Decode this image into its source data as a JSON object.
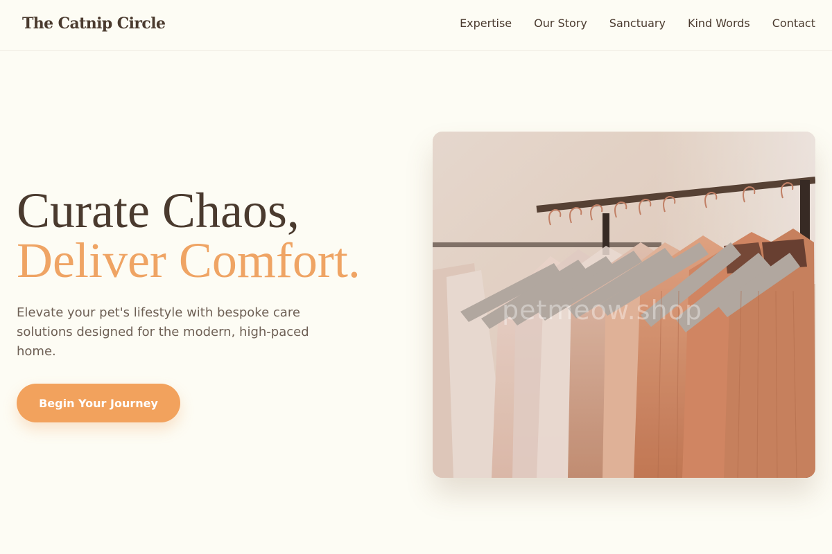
{
  "brand": {
    "name": "The Catnip Circle"
  },
  "nav": {
    "items": [
      {
        "label": "Expertise"
      },
      {
        "label": "Our Story"
      },
      {
        "label": "Sanctuary"
      },
      {
        "label": "Kind Words"
      },
      {
        "label": "Contact"
      }
    ]
  },
  "hero": {
    "title_line1": "Curate Chaos,",
    "title_line2": "Deliver Comfort.",
    "subtitle": "Elevate your pet's lifestyle with bespoke care solutions designed for the modern, high-paced home.",
    "cta_label": "Begin Your Journey",
    "image_watermark": "petmeow.shop"
  },
  "colors": {
    "background": "#fdfcf4",
    "text": "#4a3a2e",
    "accent": "#f2a25d",
    "muted": "#6e6055"
  }
}
